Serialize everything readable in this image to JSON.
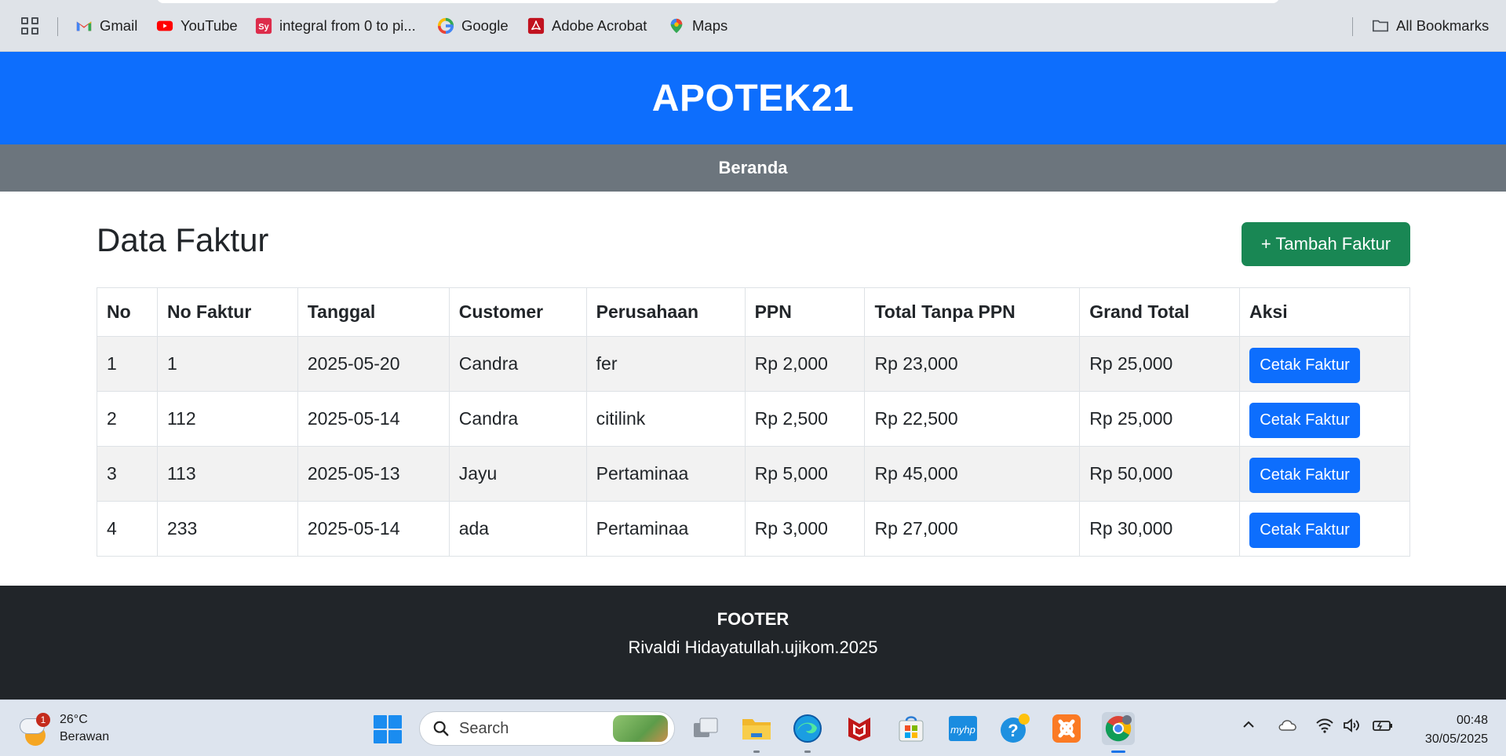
{
  "bookmarks": {
    "items": [
      {
        "label": "Gmail",
        "icon": "gmail-icon"
      },
      {
        "label": "YouTube",
        "icon": "youtube-icon"
      },
      {
        "label": "integral from 0 to pi...",
        "icon": "symbolab-icon"
      },
      {
        "label": "Google",
        "icon": "google-icon"
      },
      {
        "label": "Adobe Acrobat",
        "icon": "acrobat-icon"
      },
      {
        "label": "Maps",
        "icon": "maps-icon"
      }
    ],
    "all_label": "All Bookmarks"
  },
  "header": {
    "title": "APOTEK21"
  },
  "nav": {
    "home": "Beranda"
  },
  "main": {
    "heading": "Data Faktur",
    "add_button": "+ Tambah Faktur",
    "columns": [
      "No",
      "No Faktur",
      "Tanggal",
      "Customer",
      "Perusahaan",
      "PPN",
      "Total Tanpa PPN",
      "Grand Total",
      "Aksi"
    ],
    "rows": [
      {
        "no": "1",
        "no_faktur": "1",
        "tanggal": "2025-05-20",
        "customer": "Candra",
        "perusahaan": "fer",
        "ppn": "Rp 2,000",
        "total_tanpa_ppn": "Rp 23,000",
        "grand_total": "Rp 25,000",
        "action": "Cetak Faktur"
      },
      {
        "no": "2",
        "no_faktur": "112",
        "tanggal": "2025-05-14",
        "customer": "Candra",
        "perusahaan": "citilink",
        "ppn": "Rp 2,500",
        "total_tanpa_ppn": "Rp 22,500",
        "grand_total": "Rp 25,000",
        "action": "Cetak Faktur"
      },
      {
        "no": "3",
        "no_faktur": "113",
        "tanggal": "2025-05-13",
        "customer": "Jayu",
        "perusahaan": "Pertaminaa",
        "ppn": "Rp 5,000",
        "total_tanpa_ppn": "Rp 45,000",
        "grand_total": "Rp 50,000",
        "action": "Cetak Faktur"
      },
      {
        "no": "4",
        "no_faktur": "233",
        "tanggal": "2025-05-14",
        "customer": "ada",
        "perusahaan": "Pertaminaa",
        "ppn": "Rp 3,000",
        "total_tanpa_ppn": "Rp 27,000",
        "grand_total": "Rp 30,000",
        "action": "Cetak Faktur"
      }
    ]
  },
  "footer": {
    "title": "FOOTER",
    "text": "Rivaldi Hidayatullah.ujikom.2025"
  },
  "taskbar": {
    "weather_temp": "26°C",
    "weather_desc": "Berawan",
    "weather_badge": "1",
    "search_placeholder": "Search",
    "time": "00:48",
    "date": "30/05/2025"
  },
  "colors": {
    "header": "#0d6efd",
    "navbar": "#6c757d",
    "add_button": "#198754",
    "print_button": "#0d6efd",
    "footer": "#212529"
  }
}
